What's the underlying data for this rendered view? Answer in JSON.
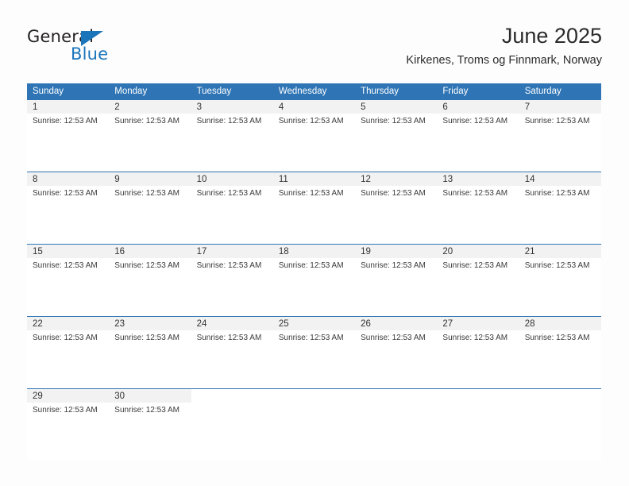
{
  "logo": {
    "word1": "General",
    "word2": "Blue",
    "triangle_icon": "triangle-icon",
    "brand_color": "#1b75bb",
    "text_color": "#231f20"
  },
  "header": {
    "title": "June 2025",
    "subtitle": "Kirkenes, Troms og Finnmark, Norway"
  },
  "theme": {
    "header_blue": "#2f75b5",
    "day_band_gray": "#f2f2f2",
    "page_background": "#fdfdfd"
  },
  "calendar": {
    "weekday_headers": [
      "Sunday",
      "Monday",
      "Tuesday",
      "Wednesday",
      "Thursday",
      "Friday",
      "Saturday"
    ],
    "weeks": [
      [
        {
          "day": "1",
          "event": "Sunrise: 12:53 AM"
        },
        {
          "day": "2",
          "event": "Sunrise: 12:53 AM"
        },
        {
          "day": "3",
          "event": "Sunrise: 12:53 AM"
        },
        {
          "day": "4",
          "event": "Sunrise: 12:53 AM"
        },
        {
          "day": "5",
          "event": "Sunrise: 12:53 AM"
        },
        {
          "day": "6",
          "event": "Sunrise: 12:53 AM"
        },
        {
          "day": "7",
          "event": "Sunrise: 12:53 AM"
        }
      ],
      [
        {
          "day": "8",
          "event": "Sunrise: 12:53 AM"
        },
        {
          "day": "9",
          "event": "Sunrise: 12:53 AM"
        },
        {
          "day": "10",
          "event": "Sunrise: 12:53 AM"
        },
        {
          "day": "11",
          "event": "Sunrise: 12:53 AM"
        },
        {
          "day": "12",
          "event": "Sunrise: 12:53 AM"
        },
        {
          "day": "13",
          "event": "Sunrise: 12:53 AM"
        },
        {
          "day": "14",
          "event": "Sunrise: 12:53 AM"
        }
      ],
      [
        {
          "day": "15",
          "event": "Sunrise: 12:53 AM"
        },
        {
          "day": "16",
          "event": "Sunrise: 12:53 AM"
        },
        {
          "day": "17",
          "event": "Sunrise: 12:53 AM"
        },
        {
          "day": "18",
          "event": "Sunrise: 12:53 AM"
        },
        {
          "day": "19",
          "event": "Sunrise: 12:53 AM"
        },
        {
          "day": "20",
          "event": "Sunrise: 12:53 AM"
        },
        {
          "day": "21",
          "event": "Sunrise: 12:53 AM"
        }
      ],
      [
        {
          "day": "22",
          "event": "Sunrise: 12:53 AM"
        },
        {
          "day": "23",
          "event": "Sunrise: 12:53 AM"
        },
        {
          "day": "24",
          "event": "Sunrise: 12:53 AM"
        },
        {
          "day": "25",
          "event": "Sunrise: 12:53 AM"
        },
        {
          "day": "26",
          "event": "Sunrise: 12:53 AM"
        },
        {
          "day": "27",
          "event": "Sunrise: 12:53 AM"
        },
        {
          "day": "28",
          "event": "Sunrise: 12:53 AM"
        }
      ],
      [
        {
          "day": "29",
          "event": "Sunrise: 12:53 AM"
        },
        {
          "day": "30",
          "event": "Sunrise: 12:53 AM"
        },
        {
          "day": "",
          "event": ""
        },
        {
          "day": "",
          "event": ""
        },
        {
          "day": "",
          "event": ""
        },
        {
          "day": "",
          "event": ""
        },
        {
          "day": "",
          "event": ""
        }
      ]
    ]
  }
}
